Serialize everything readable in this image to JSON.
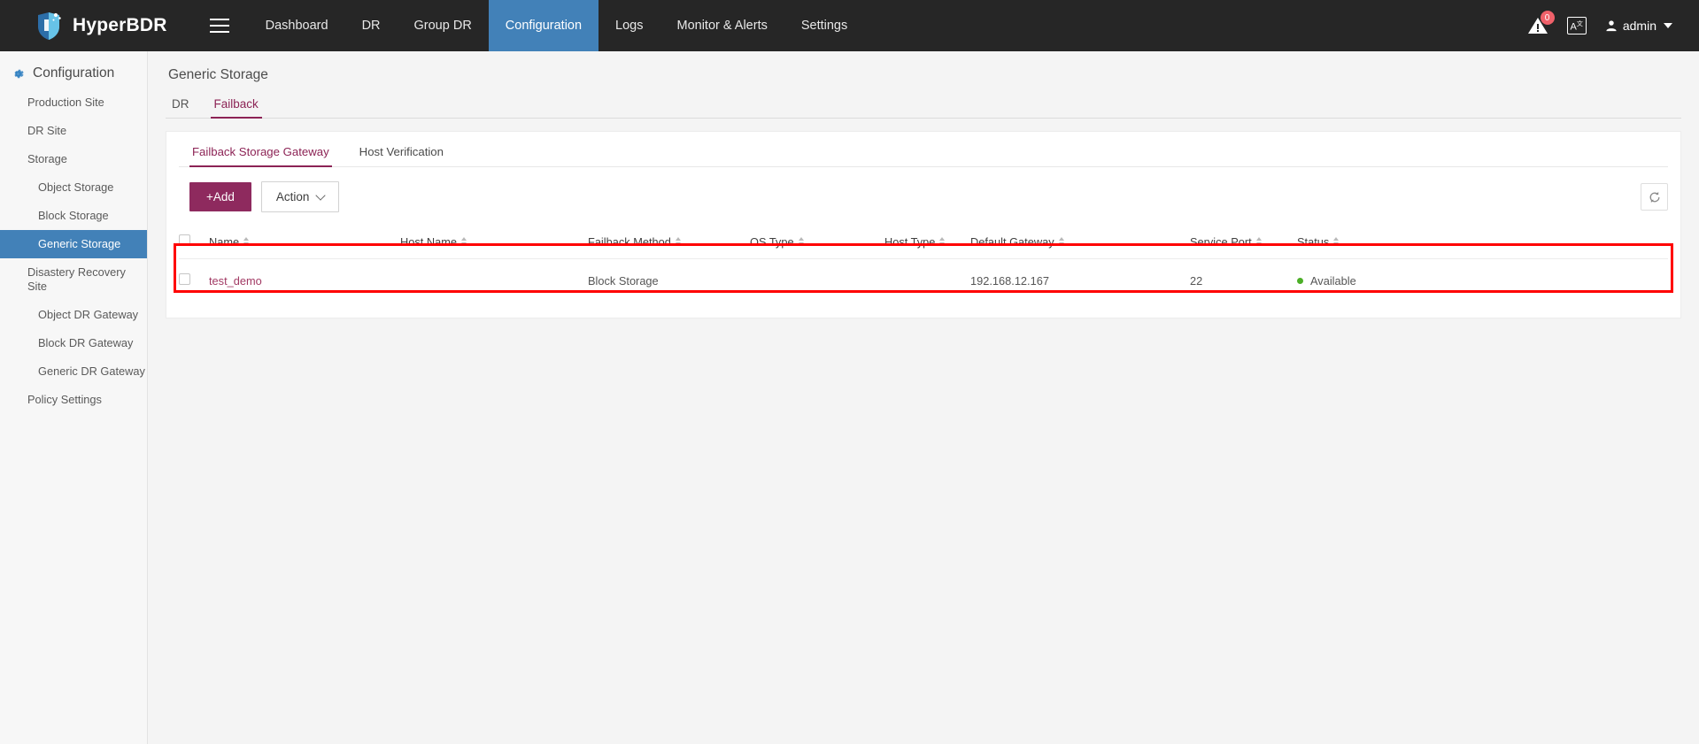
{
  "header": {
    "brand": "HyperBDR",
    "menu_icon": "hamburger-icon",
    "nav": [
      {
        "label": "Dashboard",
        "active": false
      },
      {
        "label": "DR",
        "active": false
      },
      {
        "label": "Group DR",
        "active": false
      },
      {
        "label": "Configuration",
        "active": true
      },
      {
        "label": "Logs",
        "active": false
      },
      {
        "label": "Monitor & Alerts",
        "active": false
      },
      {
        "label": "Settings",
        "active": false
      }
    ],
    "alert_badge": "0",
    "lang_label": "A",
    "lang_sup": "文",
    "user": "admin"
  },
  "sidebar": {
    "title": "Configuration",
    "items": [
      {
        "label": "Production Site",
        "level": 1,
        "active": false
      },
      {
        "label": "DR Site",
        "level": 1,
        "active": false
      },
      {
        "label": "Storage",
        "level": 1,
        "active": false
      },
      {
        "label": "Object Storage",
        "level": 2,
        "active": false
      },
      {
        "label": "Block Storage",
        "level": 2,
        "active": false
      },
      {
        "label": "Generic Storage",
        "level": 2,
        "active": true
      },
      {
        "label": "Disastery Recovery Site",
        "level": 1,
        "active": false
      },
      {
        "label": "Object DR Gateway",
        "level": 2,
        "active": false
      },
      {
        "label": "Block DR Gateway",
        "level": 2,
        "active": false
      },
      {
        "label": "Generic DR Gateway",
        "level": 2,
        "active": false
      },
      {
        "label": "Policy Settings",
        "level": 1,
        "active": false
      }
    ]
  },
  "main": {
    "page_title": "Generic Storage",
    "outer_tabs": [
      {
        "label": "DR",
        "active": false
      },
      {
        "label": "Failback",
        "active": true
      }
    ],
    "inner_tabs": [
      {
        "label": "Failback Storage Gateway",
        "active": true
      },
      {
        "label": "Host Verification",
        "active": false
      }
    ],
    "toolbar": {
      "add_label": "+Add",
      "action_label": "Action",
      "refresh_icon": "refresh-icon"
    },
    "table": {
      "columns": [
        {
          "label": "Name"
        },
        {
          "label": "Host Name"
        },
        {
          "label": "Failback Method"
        },
        {
          "label": "OS Type"
        },
        {
          "label": "Host Type"
        },
        {
          "label": "Default Gateway"
        },
        {
          "label": "Service Port"
        },
        {
          "label": "Status"
        }
      ],
      "rows": [
        {
          "name": "test_demo",
          "host_name": "",
          "failback_method": "Block Storage",
          "os_type": "",
          "host_type": "",
          "default_gateway": "192.168.12.167",
          "service_port": "22",
          "status": "Available"
        }
      ]
    }
  },
  "colors": {
    "nav_active": "#4281b8",
    "accent_maroon": "#8c2355",
    "add_button": "#8e2a5e",
    "status_green": "#4caf27",
    "highlight_red": "#ff0000",
    "badge_red": "#f0616a"
  }
}
